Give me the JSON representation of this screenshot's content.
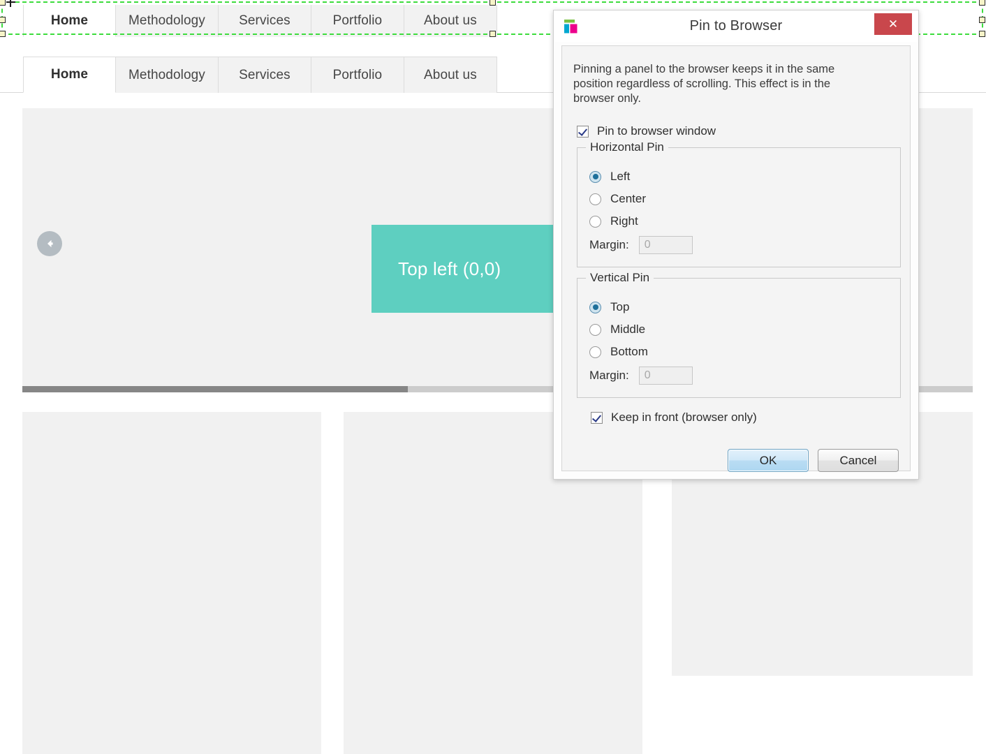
{
  "webpage": {
    "nav_selected": {
      "tabs": [
        {
          "label": "Home",
          "active": true
        },
        {
          "label": "Methodology",
          "active": false
        },
        {
          "label": "Services",
          "active": false
        },
        {
          "label": "Portfolio",
          "active": false
        },
        {
          "label": "About us",
          "active": false
        }
      ]
    },
    "nav_live": {
      "tabs": [
        {
          "label": "Home",
          "active": true
        },
        {
          "label": "Methodology",
          "active": false
        },
        {
          "label": "Services",
          "active": false
        },
        {
          "label": "Portfolio",
          "active": false
        },
        {
          "label": "About us",
          "active": false
        }
      ]
    },
    "carousel": {
      "prev_icon": "arrow-left-circle-icon",
      "progress_percent": 41
    },
    "callout": {
      "label": "Top left (0,0)",
      "color": "#5ecfc0"
    },
    "selection": {
      "color": "#3ddc3d",
      "handle_color": "#f7f4c8"
    }
  },
  "dialog": {
    "title": "Pin to Browser",
    "app_icon": "app-logo-icon",
    "close_label": "✕",
    "description": "Pinning a panel to the browser keeps it in the same position regardless of scrolling. This effect is in the browser only.",
    "pin_checkbox": {
      "label": "Pin to browser window",
      "checked": true
    },
    "horizontal_group": {
      "legend": "Horizontal Pin",
      "options": [
        {
          "label": "Left",
          "selected": true
        },
        {
          "label": "Center",
          "selected": false
        },
        {
          "label": "Right",
          "selected": false
        }
      ],
      "margin_label": "Margin:",
      "margin_value": "0"
    },
    "vertical_group": {
      "legend": "Vertical Pin",
      "options": [
        {
          "label": "Top",
          "selected": true
        },
        {
          "label": "Middle",
          "selected": false
        },
        {
          "label": "Bottom",
          "selected": false
        }
      ],
      "margin_label": "Margin:",
      "margin_value": "0"
    },
    "front_checkbox": {
      "label": "Keep in front (browser only)",
      "checked": true
    },
    "buttons": {
      "ok": "OK",
      "cancel": "Cancel"
    }
  }
}
